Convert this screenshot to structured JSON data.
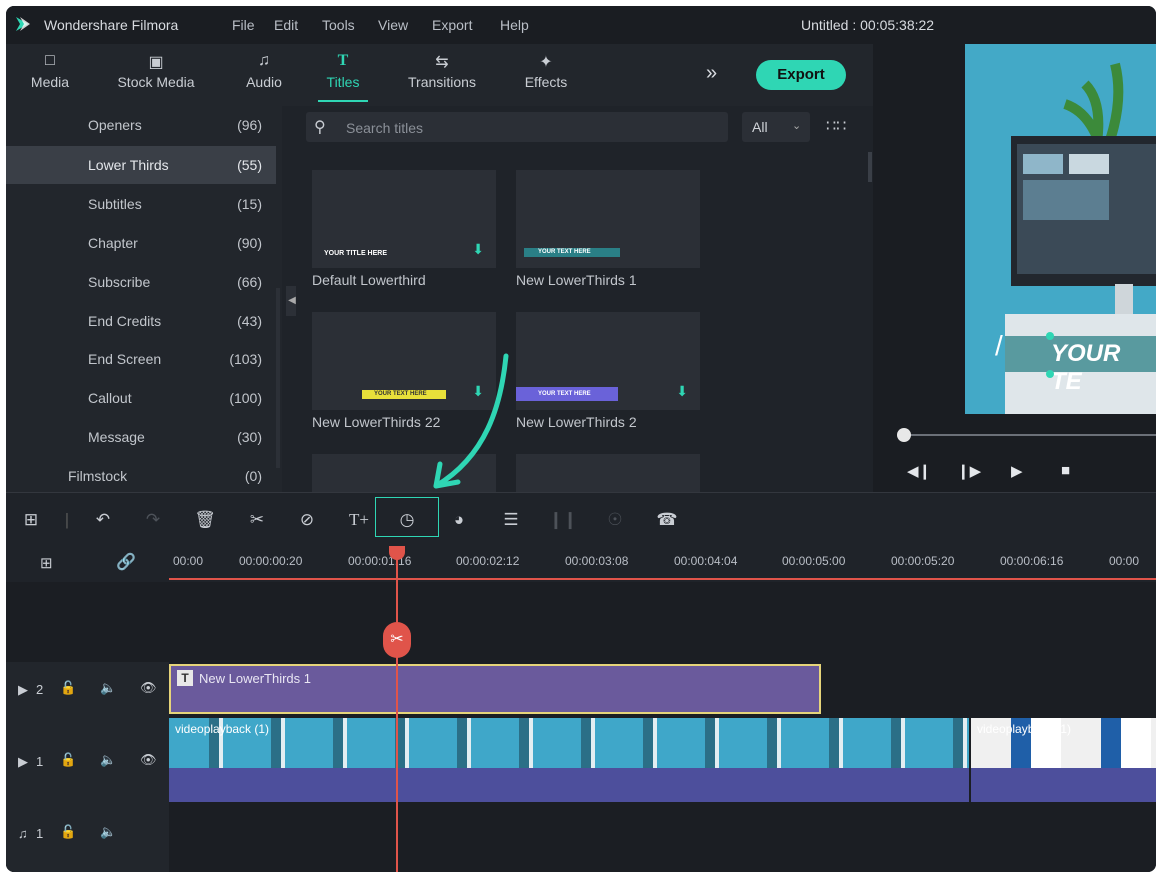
{
  "app": {
    "name": "Wondershare Filmora",
    "document": "Untitled : 00:05:38:22",
    "menu": [
      "File",
      "Edit",
      "Tools",
      "View",
      "Export",
      "Help"
    ],
    "accent_color": "#2fd6b4"
  },
  "tabs": [
    {
      "label": "Media",
      "icon": "folder-icon"
    },
    {
      "label": "Stock Media",
      "icon": "stock-media-icon"
    },
    {
      "label": "Audio",
      "icon": "music-note-icon"
    },
    {
      "label": "Titles",
      "icon": "text-t-icon",
      "active": true
    },
    {
      "label": "Transitions",
      "icon": "transitions-icon"
    },
    {
      "label": "Effects",
      "icon": "effects-icon"
    }
  ],
  "export_label": "Export",
  "categories": [
    {
      "name": "Openers",
      "count": "(96)"
    },
    {
      "name": "Lower Thirds",
      "count": "(55)",
      "selected": true
    },
    {
      "name": "Subtitles",
      "count": "(15)"
    },
    {
      "name": "Chapter",
      "count": "(90)"
    },
    {
      "name": "Subscribe",
      "count": "(66)"
    },
    {
      "name": "End Credits",
      "count": "(43)"
    },
    {
      "name": "End Screen",
      "count": "(103)"
    },
    {
      "name": "Callout",
      "count": "(100)"
    },
    {
      "name": "Message",
      "count": "(30)"
    },
    {
      "name": "Filmstock",
      "count": "(0)"
    }
  ],
  "search": {
    "placeholder": "Search titles",
    "filter": "All"
  },
  "titles": [
    {
      "label": "Default Lowerthird",
      "thumb_text": "YOUR TITLE HERE"
    },
    {
      "label": "New LowerThirds 1",
      "thumb_text": "YOUR TEXT HERE"
    },
    {
      "label": "New LowerThirds 22",
      "thumb_text": "YOUR TEXT HERE"
    },
    {
      "label": "New LowerThirds 2",
      "thumb_text": "YOUR TEXT HERE"
    }
  ],
  "preview": {
    "overlay_text": "YOUR TE"
  },
  "ruler_ticks": [
    "00:00",
    "00:00:00:20",
    "00:00:01:16",
    "00:00:02:12",
    "00:00:03:08",
    "00:00:04:04",
    "00:00:05:00",
    "00:00:05:20",
    "00:00:06:16",
    "00:00"
  ],
  "tracks": [
    {
      "id": "2"
    },
    {
      "id": "1"
    },
    {
      "id": "1"
    }
  ],
  "clips": {
    "title": "New LowerThirds 1",
    "video1": "videoplayback (1)",
    "video2": "videoplayback (1)"
  }
}
